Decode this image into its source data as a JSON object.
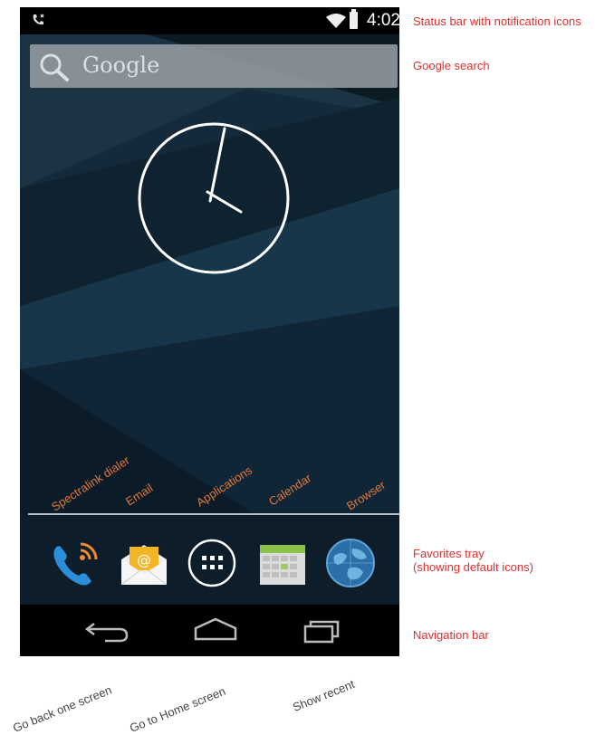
{
  "status_bar": {
    "time": "4:02",
    "icons": [
      "call-icon",
      "wifi-icon",
      "battery-icon"
    ]
  },
  "search": {
    "text": "Google",
    "icon": "search-icon"
  },
  "clock": {
    "type": "analog",
    "hour": 4,
    "minute": 2,
    "color": "#ffffff"
  },
  "favorites": [
    {
      "label": "Spectralink dialer",
      "icon": "phone-icon"
    },
    {
      "label": "Email",
      "icon": "email-icon"
    },
    {
      "label": "Applications",
      "icon": "apps-grid-icon"
    },
    {
      "label": "Calendar",
      "icon": "calendar-icon"
    },
    {
      "label": "Browser",
      "icon": "globe-icon"
    }
  ],
  "nav_bar": {
    "buttons": [
      {
        "icon": "back-icon",
        "caption": "Go back one screen"
      },
      {
        "icon": "home-icon",
        "caption": "Go to Home screen"
      },
      {
        "icon": "recent-apps-icon",
        "caption": "Show recent"
      }
    ]
  },
  "annotations": {
    "status_bar": "Status bar with notification icons",
    "search": "Google search",
    "tray_line1": "Favorites tray",
    "tray_line2": "(showing default icons)",
    "nav": "Navigation bar"
  },
  "colors": {
    "annotation_red": "#e03030",
    "app_label_orange": "#e07a3c",
    "wallpaper": "#132a3a"
  }
}
